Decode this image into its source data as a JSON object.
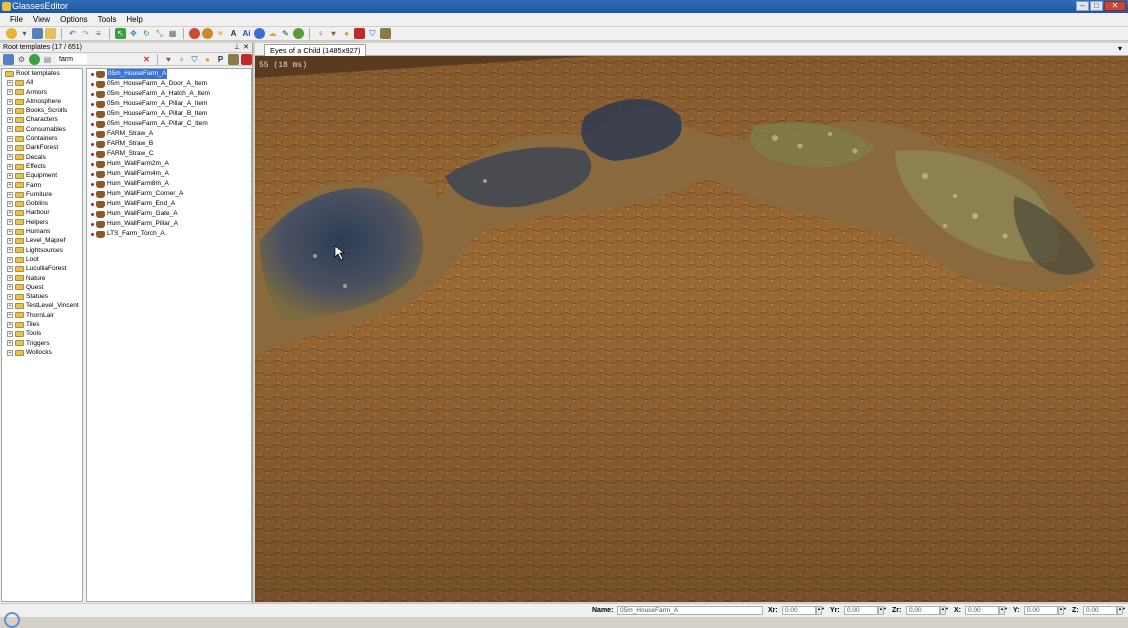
{
  "window": {
    "title": "GlassesEditor"
  },
  "menu": [
    "File",
    "View",
    "Options",
    "Tools",
    "Help"
  ],
  "left_panel": {
    "title": "Root templates (17 / 651)",
    "search_value": "farm",
    "tree_root": "Root templates",
    "tree_items": [
      "All",
      "Armors",
      "Atmosphere",
      "Books_Scrolls",
      "Characters",
      "Consumables",
      "Containers",
      "DarkForest",
      "Decals",
      "Effects",
      "Equipment",
      "Farm",
      "Furniture",
      "Goblins",
      "Harbour",
      "Helpers",
      "Humans",
      "Level_Mapref",
      "Lightsources",
      "Loot",
      "LuculliaForest",
      "Nature",
      "Quest",
      "Statues",
      "TestLevel_Vincent",
      "ThornLair",
      "Tiles",
      "Tools",
      "Triggers",
      "Wollocks"
    ],
    "list_items": [
      "05m_HouseFarm_A",
      "05m_HouseFarm_A_Door_A_Item",
      "05m_HouseFarm_A_Hatch_A_Item",
      "05m_HouseFarm_A_Pillar_A_Item",
      "05m_HouseFarm_A_Pillar_B_Item",
      "05m_HouseFarm_A_Pillar_C_Item",
      "FARM_Straw_A",
      "FARM_Straw_B",
      "FARM_Straw_C",
      "Hum_WallFarm2m_A",
      "Hum_WallFarm4m_A",
      "Hum_WallFarm8m_A",
      "Hum_WallFarm_Corner_A",
      "Hum_WallFarm_End_A",
      "Hum_WallFarm_Gate_A",
      "Hum_WallFarm_Pillar_A",
      "LTS_Farm_Torch_A"
    ],
    "selected_item": "05m_HouseFarm_A"
  },
  "viewport": {
    "tab_label": "Eyes of a Child (1485x927)",
    "fps_text": "55 (18 ms)"
  },
  "status": {
    "name_label": "Name:",
    "name_value": "05m_HouseFarm_A",
    "fields": [
      {
        "label": "Xr:",
        "value": "0.00"
      },
      {
        "label": "Yr:",
        "value": "0.00"
      },
      {
        "label": "Zr:",
        "value": "0.00"
      },
      {
        "label": "X:",
        "value": "0.00"
      },
      {
        "label": "Y:",
        "value": "0.00"
      },
      {
        "label": "Z:",
        "value": "0.00"
      }
    ]
  },
  "colors": {
    "terrain": "#9a6a38",
    "rock": "#3a4a5e",
    "moss": "#8f8a4a",
    "selection": "#3875d7"
  }
}
